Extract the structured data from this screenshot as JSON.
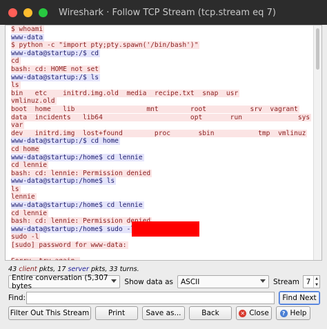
{
  "window": {
    "title": "Wireshark · Follow TCP Stream (tcp.stream eq 7) · suspicious."
  },
  "stream_lines": [
    {
      "text": "$ whoami",
      "dir": "client"
    },
    {
      "text": "www-data",
      "dir": "server"
    },
    {
      "text": "$ python -c \"import pty;pty.spawn('/bin/bash')\"",
      "dir": "client"
    },
    {
      "text": "www-data@startup:/$ cd",
      "dir": "server"
    },
    {
      "text": "cd",
      "dir": "client"
    },
    {
      "text": "bash: cd: HOME not set",
      "dir": "client"
    },
    {
      "text": "www-data@startup:/$ ls",
      "dir": "server"
    },
    {
      "text": "ls",
      "dir": "client"
    },
    {
      "text": "bin   etc    initrd.img.old  media  recipe.txt  snap  usr",
      "dir": "client"
    },
    {
      "text": "vmlinuz.old",
      "dir": "client"
    },
    {
      "text": "boot  home   lib                  mnt        root           srv  vagrant",
      "dir": "client"
    },
    {
      "text": "data  incidents   lib64                      opt       run              sys",
      "dir": "client"
    },
    {
      "text": "var",
      "dir": "client"
    },
    {
      "text": "dev   initrd.img  lost+found        proc       sbin           tmp  vmlinuz",
      "dir": "client"
    },
    {
      "text": "www-data@startup:/$ cd home",
      "dir": "server"
    },
    {
      "text": "cd home",
      "dir": "client"
    },
    {
      "text": "www-data@startup:/home$ cd lennie",
      "dir": "server"
    },
    {
      "text": "cd lennie",
      "dir": "client"
    },
    {
      "text": "bash: cd: lennie: Permission denied",
      "dir": "client"
    },
    {
      "text": "www-data@startup:/home$ ls",
      "dir": "server"
    },
    {
      "text": "ls",
      "dir": "client"
    },
    {
      "text": "lennie",
      "dir": "client"
    },
    {
      "text": "www-data@startup:/home$ cd lennie",
      "dir": "server"
    },
    {
      "text": "cd lennie",
      "dir": "client"
    },
    {
      "text": "bash: cd: lennie: Permission denied",
      "dir": "client"
    },
    {
      "text": "www-data@startup:/home$ sudo -l",
      "dir": "server"
    },
    {
      "text": "sudo -l",
      "dir": "client"
    },
    {
      "text": "[sudo] password for www-data:",
      "dir": "client"
    },
    {
      "text": "",
      "dir": "none"
    },
    {
      "text": "Sorry, try again.",
      "dir": "client"
    },
    {
      "text": "[sudo] password for www-data:",
      "dir": "client"
    }
  ],
  "stats": {
    "client_count": "43",
    "client_label": "client",
    "mid": "pkts,",
    "server_count": "17",
    "server_label": "server",
    "tail": "pkts, 33 turns."
  },
  "controls": {
    "conversation_select": "Entire conversation (5,307 bytes",
    "show_data_as_label": "Show data as",
    "format_select": "ASCII",
    "stream_label": "Stream",
    "stream_number": "7",
    "find_label": "Find:",
    "find_value": "",
    "find_next": "Find Next"
  },
  "buttons": {
    "filter_out": "Filter Out This Stream",
    "print": "Print",
    "save_as": "Save as...",
    "back": "Back",
    "close": "Close",
    "help": "Help"
  },
  "colors": {
    "client_text": "#8a1c1c",
    "client_bg": "#fbe4e4",
    "server_text": "#1d1d6e",
    "server_bg": "#e4e4fb",
    "redaction": "#ff0000"
  }
}
